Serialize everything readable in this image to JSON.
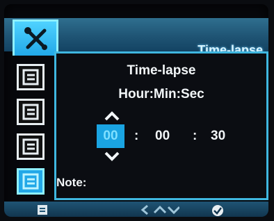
{
  "header": {
    "title": "Time-lapse",
    "tool_icon": "wrench-screwdriver-icon"
  },
  "sidebar": {
    "items": [
      {
        "icon": "menu-page-icon",
        "selected": false
      },
      {
        "icon": "menu-page-icon",
        "selected": false
      },
      {
        "icon": "menu-page-icon",
        "selected": false
      },
      {
        "icon": "menu-page-icon",
        "selected": true
      }
    ]
  },
  "panel": {
    "title": "Time-lapse",
    "format": "Hour:Min:Sec",
    "hours": "00",
    "minutes": "00",
    "seconds": "30",
    "separator": ":",
    "note_label": "Note:"
  },
  "bottombar": {
    "left_icon": "menu-page-icon",
    "nav_icon": "navigate-arrows-icon",
    "confirm_icon": "checkmark-icon"
  },
  "colors": {
    "accent": "#22a8e8",
    "header": "#1f5474",
    "border": "#3fb7e0"
  }
}
